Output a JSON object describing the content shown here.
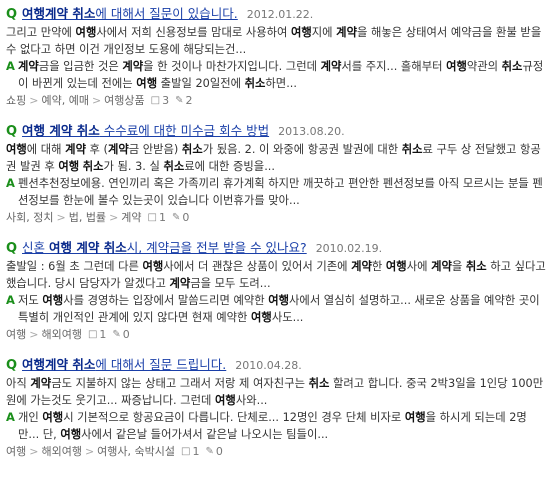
{
  "results": [
    {
      "title": [
        {
          "t": "여행계약 취소",
          "hl": true
        },
        {
          "t": "에 대해서 질문이 있습니다.",
          "hl": false
        }
      ],
      "date": "2012.01.22.",
      "question": [
        {
          "t": "그리고 만약에 ",
          "b": false
        },
        {
          "t": "여행",
          "b": true
        },
        {
          "t": "사에서 저희 신용정보를 맘대로 사용하여 ",
          "b": false
        },
        {
          "t": "여행",
          "b": true
        },
        {
          "t": "지에 ",
          "b": false
        },
        {
          "t": "계약",
          "b": true
        },
        {
          "t": "을 해놓은 상태여서 예약금을 환불 받을수 없다고 하면 이건 개인정보 도용에 해당되는건...",
          "b": false
        }
      ],
      "answer": [
        {
          "t": "계약",
          "b": true
        },
        {
          "t": "금을 입금한 것은 ",
          "b": false
        },
        {
          "t": "계약",
          "b": true
        },
        {
          "t": "을 한 것이나 마찬가지입니다. 그런데 ",
          "b": false
        },
        {
          "t": "계약",
          "b": true
        },
        {
          "t": "서를 주지... 홀해부터 ",
          "b": false
        },
        {
          "t": "여행",
          "b": true
        },
        {
          "t": "약관의 ",
          "b": false
        },
        {
          "t": "취소",
          "b": true
        },
        {
          "t": "규정이 바뀐게 있는데 전에는 ",
          "b": false
        },
        {
          "t": "여행",
          "b": true
        },
        {
          "t": " 출발일 20일전에 ",
          "b": false
        },
        {
          "t": "취소",
          "b": true
        },
        {
          "t": "하면...",
          "b": false
        }
      ],
      "categories": [
        "쇼핑",
        "예약, 예매",
        "여행상품"
      ],
      "answers": "3",
      "likes": "2"
    },
    {
      "title": [
        {
          "t": "여행 계약 취소",
          "hl": true
        },
        {
          "t": " 수수료에 대한 미수금 회수 방법",
          "hl": false
        }
      ],
      "date": "2013.08.20.",
      "question": [
        {
          "t": "여행",
          "b": true
        },
        {
          "t": "에 대해 ",
          "b": false
        },
        {
          "t": "계약",
          "b": true
        },
        {
          "t": " 후 (",
          "b": false
        },
        {
          "t": "계약",
          "b": true
        },
        {
          "t": "금 안받음) ",
          "b": false
        },
        {
          "t": "취소",
          "b": true
        },
        {
          "t": "가 됬음. 2. 이 와중에 항공권 발권에 대한 ",
          "b": false
        },
        {
          "t": "취소",
          "b": true
        },
        {
          "t": "료 구두 상 전달했고 항공권 발권 후 ",
          "b": false
        },
        {
          "t": "여행",
          "b": true
        },
        {
          "t": " ",
          "b": false
        },
        {
          "t": "취소",
          "b": true
        },
        {
          "t": "가 됨. 3. 실 ",
          "b": false
        },
        {
          "t": "취소",
          "b": true
        },
        {
          "t": "료에 대한 증빙을...",
          "b": false
        }
      ],
      "answer": [
        {
          "t": "펜션추천정보에용. 연인끼리 혹은 가족끼리 휴가계획 하지만 깨끗하고 편안한 펜션정보를 아직 모르시는 분들 펜션정보를 한눈에 볼수 있는곳이 있습니다 이번휴가를 맞아...",
          "b": false
        }
      ],
      "categories": [
        "사회, 정치",
        "법, 법률",
        "계약"
      ],
      "answers": "1",
      "likes": "0"
    },
    {
      "title": [
        {
          "t": "신혼 ",
          "hl": false
        },
        {
          "t": "여행 계약 취소",
          "hl": true
        },
        {
          "t": "시, 계약금을 전부 받을 수 있나요?",
          "hl": false
        }
      ],
      "date": "2010.02.19.",
      "question": [
        {
          "t": "출발일 : 6월 초 그런데 다른 ",
          "b": false
        },
        {
          "t": "여행",
          "b": true
        },
        {
          "t": "사에서 더 괜찮은 상품이 있어서 기존에 ",
          "b": false
        },
        {
          "t": "계약",
          "b": true
        },
        {
          "t": "한 ",
          "b": false
        },
        {
          "t": "여행",
          "b": true
        },
        {
          "t": "사에 ",
          "b": false
        },
        {
          "t": "계약",
          "b": true
        },
        {
          "t": "을 ",
          "b": false
        },
        {
          "t": "취소",
          "b": true
        },
        {
          "t": " 하고 싶다고 했습니다. 당시 담당자가 알겠다고 ",
          "b": false
        },
        {
          "t": "계약",
          "b": true
        },
        {
          "t": "금을 모두 도려...",
          "b": false
        }
      ],
      "answer": [
        {
          "t": "저도 ",
          "b": false
        },
        {
          "t": "여행",
          "b": true
        },
        {
          "t": "사를 경영하는 입장에서 말씀드리면 예약한 ",
          "b": false
        },
        {
          "t": "여행",
          "b": true
        },
        {
          "t": "사에서 열심히 설명하고... 새로운 상품을 예약한 곳이 특별히 개인적인 관계에 있지 않다면 현재 예약한 ",
          "b": false
        },
        {
          "t": "여행",
          "b": true
        },
        {
          "t": "사도...",
          "b": false
        }
      ],
      "categories": [
        "여행",
        "해외여행"
      ],
      "answers": "1",
      "likes": "0"
    },
    {
      "title": [
        {
          "t": "여행계약 취소",
          "hl": true
        },
        {
          "t": "에 대해서 질문 드립니다.",
          "hl": false
        }
      ],
      "date": "2010.04.28.",
      "question": [
        {
          "t": "아직 ",
          "b": false
        },
        {
          "t": "계약",
          "b": true
        },
        {
          "t": "금도 지불하지 않는 상태고 그래서 저랑 제 여자친구는 ",
          "b": false
        },
        {
          "t": "취소",
          "b": true
        },
        {
          "t": " 할려고 합니다. 중국 2박3일을 1인당 100만원에 가는것도 웃기고... 짜증납니다. 그런데 ",
          "b": false
        },
        {
          "t": "여행",
          "b": true
        },
        {
          "t": "사와...",
          "b": false
        }
      ],
      "answer": [
        {
          "t": "개인 ",
          "b": false
        },
        {
          "t": "여행",
          "b": true
        },
        {
          "t": "시 기본적으로 항공요금이 다릅니다. 단체로... 12명인 경우 단체 비자로 ",
          "b": false
        },
        {
          "t": "여행",
          "b": true
        },
        {
          "t": "을 하시게 되는데 2명만... 단, ",
          "b": false
        },
        {
          "t": "여행",
          "b": true
        },
        {
          "t": "사에서 같은날 들어가셔서 같은날 나오시는 팀들이...",
          "b": false
        }
      ],
      "categories": [
        "여행",
        "해외여행",
        "여행사, 숙박시설"
      ],
      "answers": "1",
      "likes": "0"
    }
  ],
  "labels": {
    "q": "Q",
    "a": "A",
    "breadcrumb_sep": ">"
  },
  "icons": {
    "answer": "speech-bubble-icon",
    "like": "like-icon"
  },
  "colors": {
    "accent_green": "#1a8e1a",
    "title_blue": "#1a3fa8"
  }
}
